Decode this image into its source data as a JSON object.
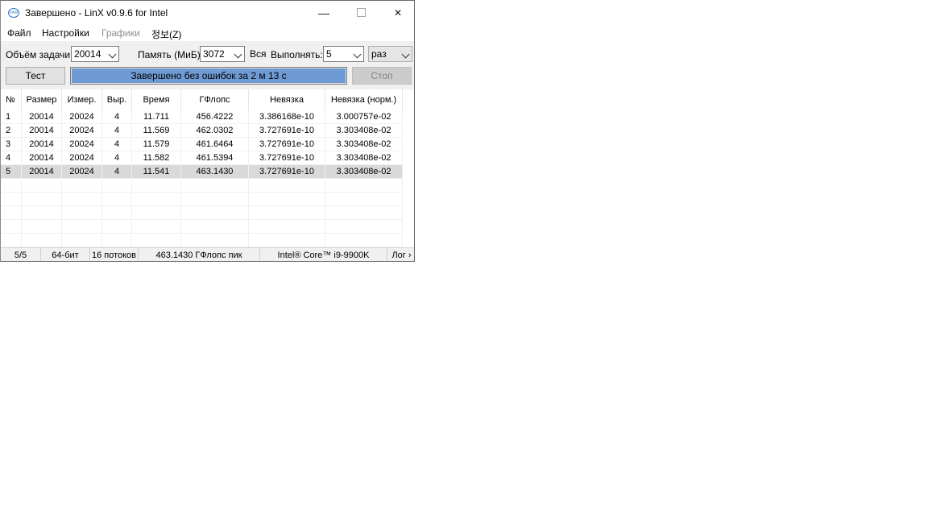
{
  "window": {
    "title": "Завершено - LinX v0.9.6 for Intel",
    "icon_text": "intel",
    "minimize_glyph": "—",
    "close_glyph": "✕"
  },
  "menu": [
    "Файл",
    "Настройки",
    "Графики",
    "정보(Z)"
  ],
  "toolbar": {
    "size_label": "Объём задачи:",
    "size_value": "20014",
    "memory_label": "Память (МиБ):",
    "memory_value": "3072",
    "all_label": "Вся",
    "run_label": "Выполнять:",
    "run_value": "5",
    "unit_value": "раз",
    "test_button": "Тест",
    "stop_button": "Стоп",
    "progress_text": "Завершено без ошибок за 2 м 13 с",
    "progress_fraction": 1.0
  },
  "table": {
    "columns": [
      "№",
      "Размер",
      "Измер.",
      "Выр.",
      "Время",
      "ГФлопс",
      "Невязка",
      "Невязка (норм.)"
    ],
    "rows": [
      [
        "1",
        "20014",
        "20024",
        "4",
        "11.711",
        "456.4222",
        "3.386168e-10",
        "3.000757e-02"
      ],
      [
        "2",
        "20014",
        "20024",
        "4",
        "11.569",
        "462.0302",
        "3.727691e-10",
        "3.303408e-02"
      ],
      [
        "3",
        "20014",
        "20024",
        "4",
        "11.579",
        "461.6464",
        "3.727691e-10",
        "3.303408e-02"
      ],
      [
        "4",
        "20014",
        "20024",
        "4",
        "11.582",
        "461.5394",
        "3.727691e-10",
        "3.303408e-02"
      ],
      [
        "5",
        "20014",
        "20024",
        "4",
        "11.541",
        "463.1430",
        "3.727691e-10",
        "3.303408e-02"
      ]
    ],
    "selected_row": 5
  },
  "status": {
    "progress": "5/5",
    "bits": "64-бит",
    "threads": "16 потоков",
    "peak": "463.1430 ГФлопс пик",
    "cpu": "Intel® Core™ i9-9900K",
    "log": "Лог ›"
  },
  "colors": {
    "progress_fill": "#6f9bd4",
    "selected_row": "#d9d9d9"
  }
}
